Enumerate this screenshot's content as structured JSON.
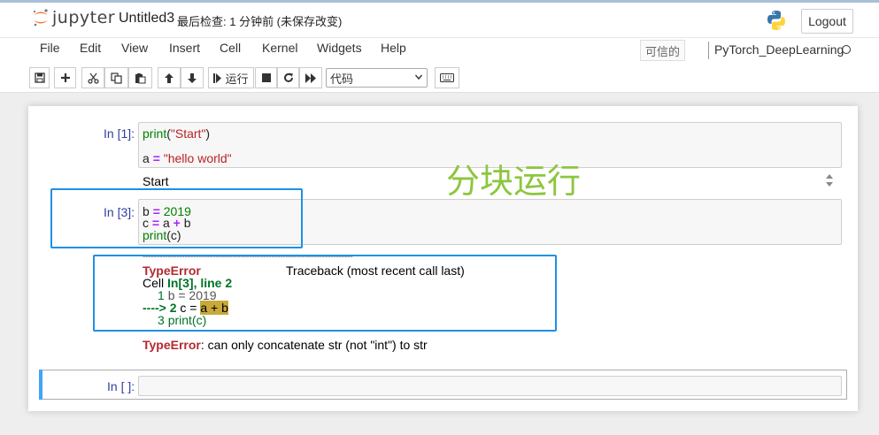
{
  "header": {
    "logo_text": "jupyter",
    "notebook_name": "Untitled3",
    "checkpoint": "最后检查: 1 分钟前  (未保存改变)",
    "logout_label": "Logout"
  },
  "menubar": {
    "items": [
      "File",
      "Edit",
      "View",
      "Insert",
      "Cell",
      "Kernel",
      "Widgets",
      "Help"
    ],
    "trusted_label": "可信的",
    "kernel_name": "PyTorch_DeepLearning"
  },
  "toolbar": {
    "run_label": "运行",
    "cell_type": "代码"
  },
  "cells": [
    {
      "prompt": "In [1]:",
      "line1": {
        "fn": "print",
        "open": "(",
        "str": "\"Start\"",
        "close": ")"
      },
      "line2": {
        "var": "a",
        "op": "=",
        "str": "\"hello world\""
      },
      "output": "Start"
    },
    {
      "prompt": "In [3]:",
      "line1": {
        "var": "b",
        "op": "=",
        "num": "2019"
      },
      "line2": {
        "var": "c",
        "op": "=",
        "a": "a",
        "plus": "+",
        "b": "b"
      },
      "line3": {
        "fn": "print",
        "arg": "(c)"
      },
      "traceback": {
        "dashes": "---------------------------------------------------------------------------",
        "error_name": "TypeError",
        "traceback_label": "Traceback (most recent call last)",
        "cell_prefix": "Cell ",
        "cell_ref": "In[3], line 2",
        "tb_line1_num": "1",
        "tb_line1": "b = 2019",
        "tb_arrow": "----> 2",
        "tb_line2_pre": "c = ",
        "tb_line2_hl": "a + b",
        "tb_line3_num": "3",
        "tb_line3": "print(c)",
        "final_error_name": "TypeError",
        "final_error_msg": ": can only concatenate str (not \"int\") to str"
      }
    },
    {
      "prompt": "In [ ]:"
    }
  ],
  "annotation_text": "分块运行",
  "colors": {
    "annotation": "#8dc63f",
    "highlight_box": "#1e90e6",
    "prompt": "#303f9f",
    "error": "#b22b31"
  }
}
